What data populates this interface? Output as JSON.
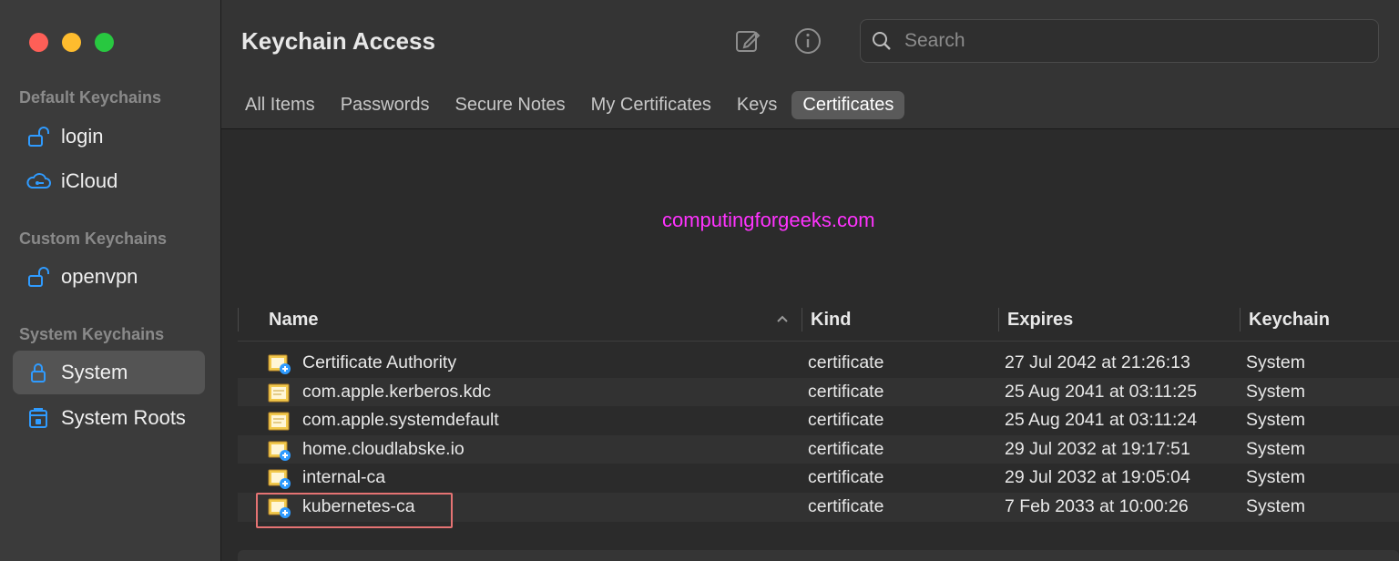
{
  "window": {
    "title": "Keychain Access"
  },
  "sidebar": {
    "sections": [
      {
        "title": "Default Keychains",
        "items": [
          {
            "label": "login",
            "icon": "lock-open-icon"
          },
          {
            "label": "iCloud",
            "icon": "cloud-icon"
          }
        ]
      },
      {
        "title": "Custom Keychains",
        "items": [
          {
            "label": "openvpn",
            "icon": "lock-open-icon"
          }
        ]
      },
      {
        "title": "System Keychains",
        "items": [
          {
            "label": "System",
            "icon": "lock-icon",
            "selected": true
          },
          {
            "label": "System Roots",
            "icon": "cabinet-icon"
          }
        ]
      }
    ]
  },
  "toolbar": {
    "compose_icon": "compose-icon",
    "info_icon": "info-icon",
    "search_placeholder": "Search"
  },
  "tabs": [
    {
      "label": "All Items"
    },
    {
      "label": "Passwords"
    },
    {
      "label": "Secure Notes"
    },
    {
      "label": "My Certificates"
    },
    {
      "label": "Keys"
    },
    {
      "label": "Certificates",
      "active": true
    }
  ],
  "watermark": "computingforgeeks.com",
  "table": {
    "columns": [
      "Name",
      "Kind",
      "Expires",
      "Keychain"
    ],
    "rows": [
      {
        "name": "Certificate Authority",
        "kind": "certificate",
        "expires": "27 Jul 2042 at 21:26:13",
        "keychain": "System",
        "icon": "certificate-root-icon"
      },
      {
        "name": "com.apple.kerberos.kdc",
        "kind": "certificate",
        "expires": "25 Aug 2041 at 03:11:25",
        "keychain": "System",
        "icon": "certificate-icon"
      },
      {
        "name": "com.apple.systemdefault",
        "kind": "certificate",
        "expires": "25 Aug 2041 at 03:11:24",
        "keychain": "System",
        "icon": "certificate-icon"
      },
      {
        "name": "home.cloudlabske.io",
        "kind": "certificate",
        "expires": "29 Jul 2032 at 19:17:51",
        "keychain": "System",
        "icon": "certificate-root-icon"
      },
      {
        "name": "internal-ca",
        "kind": "certificate",
        "expires": "29 Jul 2032 at 19:05:04",
        "keychain": "System",
        "icon": "certificate-root-icon"
      },
      {
        "name": "kubernetes-ca",
        "kind": "certificate",
        "expires": "7 Feb 2033 at 10:00:26",
        "keychain": "System",
        "icon": "certificate-root-icon"
      }
    ]
  },
  "colors": {
    "accent": "#2f9bff",
    "watermark": "#ff33ff",
    "highlight": "#e57373"
  }
}
